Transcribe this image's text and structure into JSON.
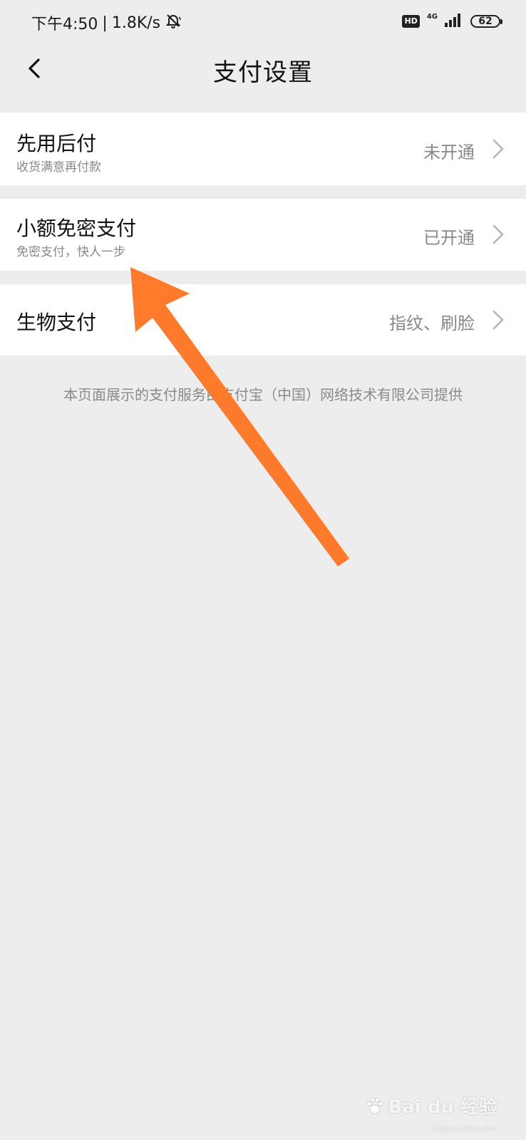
{
  "status_bar": {
    "time": "下午4:50",
    "separator": "|",
    "speed": "1.8K/s",
    "hd": "HD",
    "network": "4G",
    "battery": "62"
  },
  "nav": {
    "title": "支付设置"
  },
  "rows": [
    {
      "title": "先用后付",
      "subtitle": "收货满意再付款",
      "status": "未开通"
    },
    {
      "title": "小额免密支付",
      "subtitle": "免密支付，快人一步",
      "status": "已开通"
    },
    {
      "title": "生物支付",
      "subtitle": "",
      "status": "指纹、刷脸"
    }
  ],
  "footer": {
    "note": "本页面展示的支付服务由支付宝（中国）网络技术有限公司提供"
  },
  "watermark": {
    "brand": "Bai du 经验",
    "url": "jingyan.baidu.com"
  },
  "colors": {
    "background": "#ededed",
    "row_background": "#ffffff",
    "arrow": "#ff7a2b"
  }
}
